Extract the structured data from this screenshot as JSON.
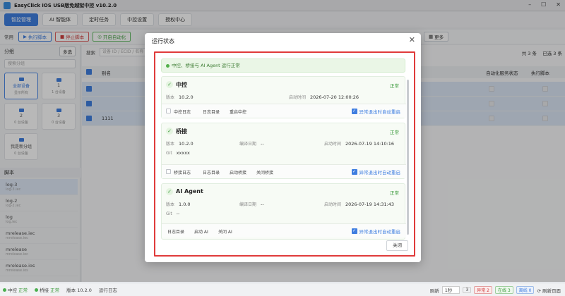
{
  "window": {
    "title": "EasyClick iOS USB版免越狱中控 v10.2.0"
  },
  "nav": {
    "tabs": [
      {
        "label": "智控管理"
      },
      {
        "label": "AI 智能体"
      },
      {
        "label": "定时任务"
      },
      {
        "label": "中控设置"
      },
      {
        "label": "授权中心"
      }
    ]
  },
  "toolbar": {
    "label": "常用",
    "run": "执行脚本",
    "stop": "停止脚本",
    "auto": "开启自动化",
    "more": "更多"
  },
  "left": {
    "group_title": "分组",
    "multi": "多选",
    "search_placeholder": "搜索分组",
    "groups": [
      {
        "name": "全部设备",
        "sub": "显示所有"
      },
      {
        "name": "1",
        "sub": "1 台设备"
      },
      {
        "name": "2",
        "sub": "0 台设备"
      },
      {
        "name": "3",
        "sub": "0 台设备"
      },
      {
        "name": "我是新分组",
        "sub": "0 台设备"
      }
    ],
    "script_title": "脚本",
    "scripts": [
      {
        "name": "log-3",
        "sub": "log-3.iec"
      },
      {
        "name": "log-2",
        "sub": "log-2.iec"
      },
      {
        "name": "log",
        "sub": "log.iec"
      },
      {
        "name": "mrelease.iec",
        "sub": "mrelease.iec"
      },
      {
        "name": "mrelease",
        "sub": "mrelease.iec"
      },
      {
        "name": "mrelease.ios",
        "sub": "mrelease.ios"
      }
    ]
  },
  "main": {
    "search_label": "搜索",
    "search_placeholder": "设备 ID / ECID / 名称",
    "total": "共 3 条",
    "selected": "已选 3 条",
    "col_name": "别名",
    "col_svc": "自动化服务状态",
    "col_script": "执行脚本",
    "rows": [
      {
        "name": ""
      },
      {
        "name": ""
      },
      {
        "name": "1111"
      }
    ]
  },
  "dialog": {
    "title": "运行状态",
    "banner": "中控、桥接与 AI Agent 运行正常",
    "services": [
      {
        "name": "中控",
        "state": "正常",
        "version_label": "版本",
        "version": "10.2.0",
        "start_label": "启动时间",
        "start": "2026-07-20 12:00:26",
        "actions": [
          "中控日志",
          "日志目录",
          "重启中控"
        ],
        "auto": "异常退出时自动重启"
      },
      {
        "name": "桥接",
        "state": "正常",
        "version_label": "版本",
        "version": "10.2.0",
        "build_label": "编译日期",
        "build": "--",
        "start_label": "启动时间",
        "start": "2026-07-19 14:10:16",
        "git_label": "Git",
        "git": "xxxxx",
        "actions": [
          "桥接日志",
          "日志目录",
          "启动桥接",
          "关闭桥接"
        ],
        "auto": "异常退出时自动重启"
      },
      {
        "name": "AI Agent",
        "state": "正常",
        "version_label": "版本",
        "version": "1.0.0",
        "build_label": "编译日期",
        "build": "--",
        "start_label": "启动时间",
        "start": "2026-07-19 14:31:43",
        "git_label": "Git",
        "git": "--",
        "actions": [
          "日志目录",
          "启动 AI",
          "关闭 AI"
        ],
        "auto": "异常退出时自动重启"
      }
    ],
    "close": "关闭"
  },
  "statusbar": {
    "center": "中控",
    "center_state": "正常",
    "bridge": "桥接",
    "bridge_state": "正常",
    "version_label": "版本",
    "version": "10.2.0",
    "log": "运行日志",
    "refresh_label": "刷新",
    "refresh_value": "1秒",
    "b1": "3",
    "b2": "异常 2",
    "b3": "在线 3",
    "b4": "离线 0",
    "refresh_page": "刷新页面"
  }
}
